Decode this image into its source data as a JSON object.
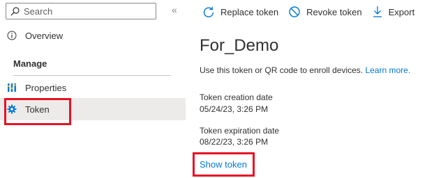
{
  "sidebar": {
    "search_placeholder": "Search",
    "collapse_glyph": "«",
    "overview_label": "Overview",
    "section_label": "Manage",
    "properties_label": "Properties",
    "token_label": "Token",
    "icons": {
      "search": "search-icon",
      "overview": "info-icon",
      "properties": "properties-icon",
      "token": "gear-icon"
    }
  },
  "toolbar": {
    "replace_label": "Replace token",
    "revoke_label": "Revoke token",
    "export_label": "Export"
  },
  "main": {
    "title": "For_Demo",
    "description": "Use this token or QR code to enroll devices.",
    "learn_more": "Learn more.",
    "creation_label": "Token creation date",
    "creation_value": "05/24/23, 3:26 PM",
    "expiration_label": "Token expiration date",
    "expiration_value": "08/22/23, 3:26 PM",
    "show_token": "Show token"
  },
  "colors": {
    "accent": "#0078d4",
    "highlight": "#e81123",
    "selected_bg": "#edebe9"
  }
}
